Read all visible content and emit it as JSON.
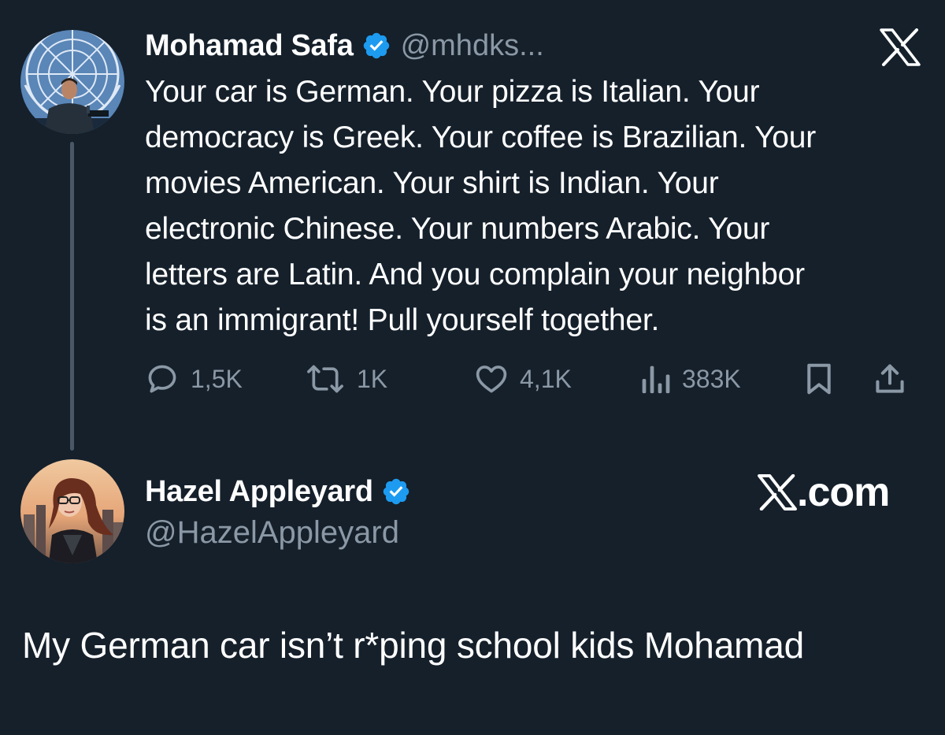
{
  "tweet": {
    "author_name": "Mohamad Safa",
    "author_handle": "@mhdks...",
    "text": "Your car is German. Your pizza is Italian. Your\ndemocracy is Greek. Your coffee is Brazilian. Your\nmovies American. Your shirt is Indian. Your\nelectronic Chinese. Your numbers Arabic. Your\nletters are Latin. And you complain your neighbor\nis an immigrant! Pull yourself together.",
    "stats": {
      "replies": "1,5K",
      "retweets": "1K",
      "likes": "4,1K",
      "views": "383K"
    }
  },
  "reply": {
    "author_name": "Hazel Appleyard",
    "author_handle": "@HazelAppleyard",
    "text": "My German car isn’t r*ping school kids Mohamad"
  },
  "brand": {
    "site": ".com"
  },
  "colors": {
    "background": "#15202b",
    "verified": "#1d9bf0",
    "secondary_text": "#8b98a5",
    "thread_line": "#4a5866"
  },
  "icons": [
    "x-logo-icon",
    "verified-badge-icon",
    "reply-icon",
    "retweet-icon",
    "heart-icon",
    "views-icon",
    "bookmark-icon",
    "share-icon"
  ]
}
